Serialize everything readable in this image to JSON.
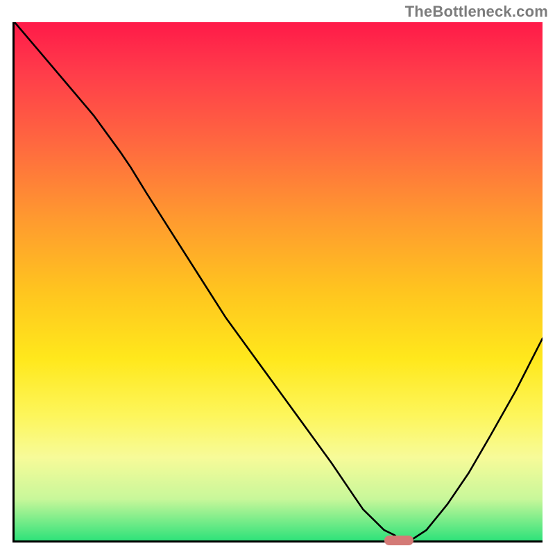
{
  "watermark": "TheBottleneck.com",
  "chart_data": {
    "type": "line",
    "title": "",
    "xlabel": "",
    "ylabel": "",
    "xlim": [
      0,
      100
    ],
    "ylim": [
      0,
      100
    ],
    "x": [
      0,
      5,
      10,
      15,
      20,
      22,
      25,
      30,
      35,
      40,
      45,
      50,
      55,
      60,
      64,
      66,
      68,
      70,
      72,
      73,
      75,
      78,
      82,
      86,
      90,
      95,
      100
    ],
    "y": [
      100,
      94,
      88,
      82,
      75,
      72,
      67,
      59,
      51,
      43,
      36,
      29,
      22,
      15,
      9,
      6,
      4,
      2,
      1,
      0,
      0,
      2,
      7,
      13,
      20,
      29,
      39
    ],
    "marker": {
      "x_start": 70,
      "x_end": 75.5,
      "y": 0
    },
    "gradient_colors": {
      "top": "#ff1a49",
      "mid": "#ffe81c",
      "bottom": "#2fe27a"
    }
  }
}
